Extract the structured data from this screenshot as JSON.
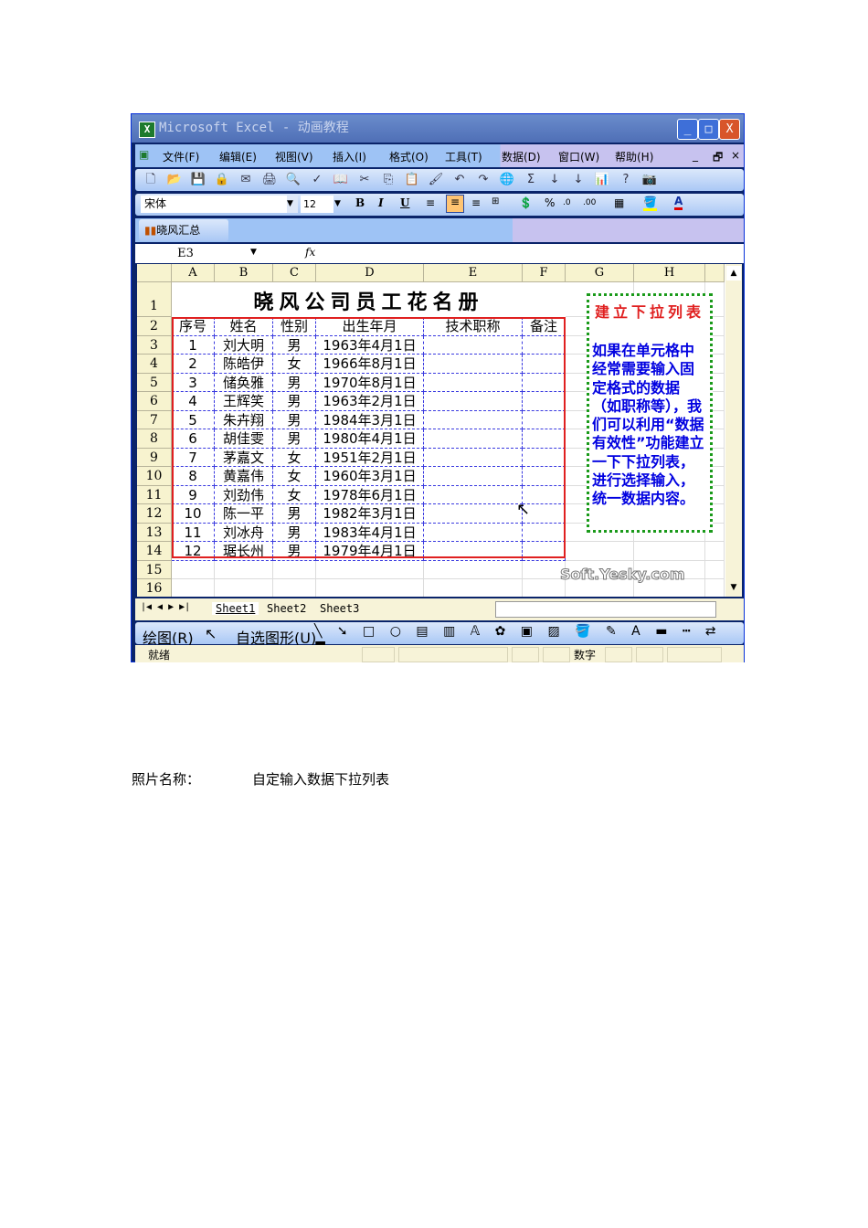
{
  "window": {
    "title": "Microsoft Excel - 动画教程",
    "minimize": "_",
    "maximize": "□",
    "close": "X"
  },
  "menu": {
    "items": [
      "文件(F)",
      "编辑(E)",
      "视图(V)",
      "插入(I)",
      "格式(O)",
      "工具(T)",
      "数据(D)",
      "窗口(W)",
      "帮助(H)"
    ],
    "doc_min": "_",
    "doc_restore": "🗗",
    "doc_close": "×"
  },
  "standard_toolbar": {
    "icons": [
      "new-icon",
      "open-icon",
      "save-icon",
      "permission-icon",
      "email-icon",
      "print-icon",
      "print-preview-icon",
      "spelling-icon",
      "research-icon",
      "cut-icon",
      "copy-icon",
      "paste-icon",
      "format-painter-icon",
      "undo-icon",
      "redo-icon",
      "hyperlink-icon",
      "autosum-icon",
      "sort-ascending-icon",
      "sort-descending-icon",
      "chart-wizard-icon",
      "help-icon",
      "camera-icon"
    ],
    "glyphs": [
      "🗋",
      "📂",
      "💾",
      "🔒",
      "✉",
      "🖨",
      "🔍",
      "✓",
      "📖",
      "✂",
      "⎘",
      "📋",
      "🖌",
      "↶",
      "↷",
      "🌐",
      "Σ",
      "↓",
      "↓",
      "📊",
      "?",
      "📷"
    ]
  },
  "format_toolbar": {
    "font": "宋体",
    "size": "12",
    "bold": "B",
    "italic": "I",
    "underline": "U",
    "percent": "%",
    "inc_decimal": ".0",
    "dec_decimal": ".00"
  },
  "custom_toolbar": {
    "label": "晓风汇总"
  },
  "formula_bar": {
    "name_box": "E3",
    "fx": "fx",
    "value": ""
  },
  "sheet": {
    "columns": [
      "A",
      "B",
      "C",
      "D",
      "E",
      "F",
      "G",
      "H"
    ],
    "row_numbers": [
      "1",
      "2",
      "3",
      "4",
      "5",
      "6",
      "7",
      "8",
      "9",
      "10",
      "11",
      "12",
      "13",
      "14",
      "15",
      "16"
    ],
    "title": "晓风公司员工花名册",
    "headers": [
      "序号",
      "姓名",
      "性别",
      "出生年月",
      "技术职称",
      "备注"
    ],
    "rows": [
      [
        "1",
        "刘大明",
        "男",
        "1963年4月1日",
        "",
        ""
      ],
      [
        "2",
        "陈皓伊",
        "女",
        "1966年8月1日",
        "",
        ""
      ],
      [
        "3",
        "储奂雅",
        "男",
        "1970年8月1日",
        "",
        ""
      ],
      [
        "4",
        "王辉笑",
        "男",
        "1963年2月1日",
        "",
        ""
      ],
      [
        "5",
        "朱卉翔",
        "男",
        "1984年3月1日",
        "",
        ""
      ],
      [
        "6",
        "胡佳雯",
        "男",
        "1980年4月1日",
        "",
        ""
      ],
      [
        "7",
        "茅嘉文",
        "女",
        "1951年2月1日",
        "",
        ""
      ],
      [
        "8",
        "黄嘉伟",
        "女",
        "1960年3月1日",
        "",
        ""
      ],
      [
        "9",
        "刘劲伟",
        "女",
        "1978年6月1日",
        "",
        ""
      ],
      [
        "10",
        "陈一平",
        "男",
        "1982年3月1日",
        "",
        ""
      ],
      [
        "11",
        "刘冰舟",
        "男",
        "1983年4月1日",
        "",
        ""
      ],
      [
        "12",
        "琚长州",
        "男",
        "1979年4月1日",
        "",
        ""
      ]
    ],
    "note_title": "建立下拉列表",
    "note_body": "如果在单元格中经常需要输入固定格式的数据（如职称等），我们可以利用“数据有效性”功能建立一下下拉列表，进行选择输入，统一数据内容。",
    "watermark": "Soft.Yesky.com"
  },
  "tabs": [
    "Sheet1",
    "Sheet2",
    "Sheet3"
  ],
  "drawing_toolbar": {
    "draw": "绘图(R)",
    "autoshapes": "自选图形(U)"
  },
  "status": {
    "ready": "就绪",
    "num": "数字"
  },
  "caption": {
    "label": "照片名称：",
    "value": "自定输入数据下拉列表"
  },
  "colors": {
    "accent": "#e02020",
    "note_text": "#0000e0",
    "grid_dash": "#3a3ae0"
  }
}
